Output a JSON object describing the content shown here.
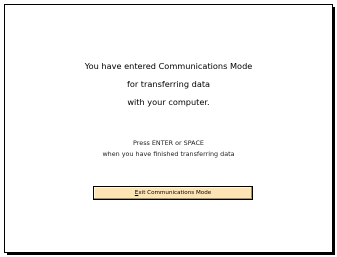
{
  "dialog": {
    "line1": "You have entered Communications Mode",
    "line2": "for transferring data",
    "line3": "with your computer.",
    "instruction1": "Press ENTER or SPACE",
    "instruction2": "when you have finished transferring data"
  },
  "exit_button": {
    "mnemonic": "E",
    "label_rest": "xit Communications Mode"
  },
  "colors": {
    "button_bg": "#fce4b4",
    "border": "#000000"
  }
}
